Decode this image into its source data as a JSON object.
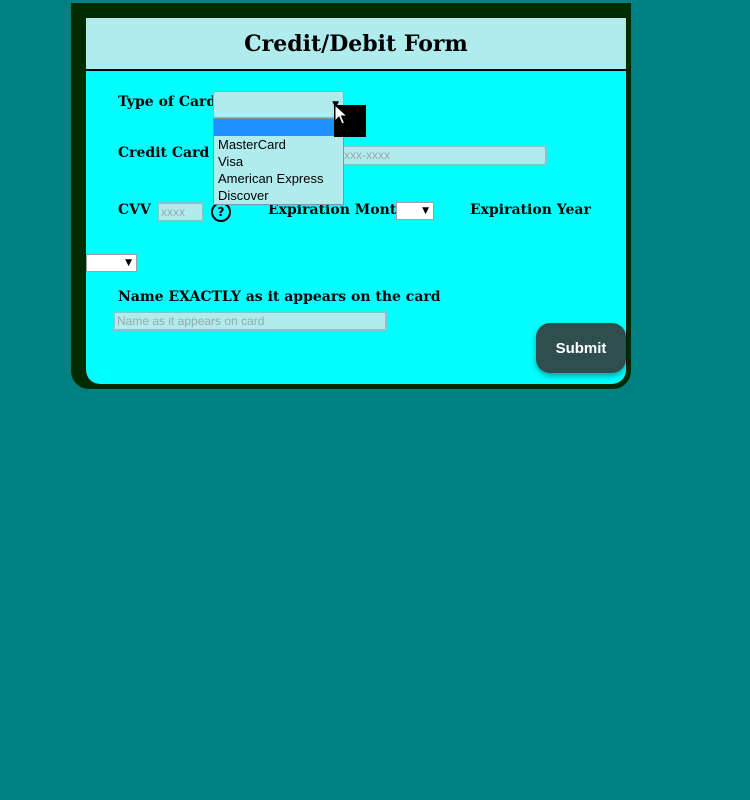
{
  "form": {
    "title": "Credit/Debit Form",
    "card_type_label": "Type of Card",
    "card_type_selected": "",
    "card_number_label": "Credit Card N",
    "card_number_placeholder": "xxx-xxxx",
    "cvv_label": "CVV",
    "cvv_placeholder": "xxxx",
    "help_icon_text": "?",
    "exp_month_label": "Expiration Month",
    "exp_month_selected": "",
    "exp_year_label": "Expiration Year",
    "exp_year_selected": "",
    "name_label": "Name EXACTLY as it appears on the card",
    "name_placeholder": "Name as it appears on card",
    "submit_label": "Submit"
  },
  "card_type_dropdown": {
    "options": [
      "",
      "MasterCard",
      "Visa",
      "American Express",
      "Discover"
    ],
    "highlighted_index": 0
  },
  "colors": {
    "page_background": "#008080",
    "card_background": "#00ffff",
    "header_background": "#b0ebed",
    "frame": "#002b00",
    "submit_background": "#2f4f4f",
    "dropdown_highlight": "#1e90ff"
  },
  "icons": {
    "help": "question-circle-icon",
    "dropdown_arrow": "chevron-down-icon",
    "cursor": "mouse-pointer-icon"
  }
}
